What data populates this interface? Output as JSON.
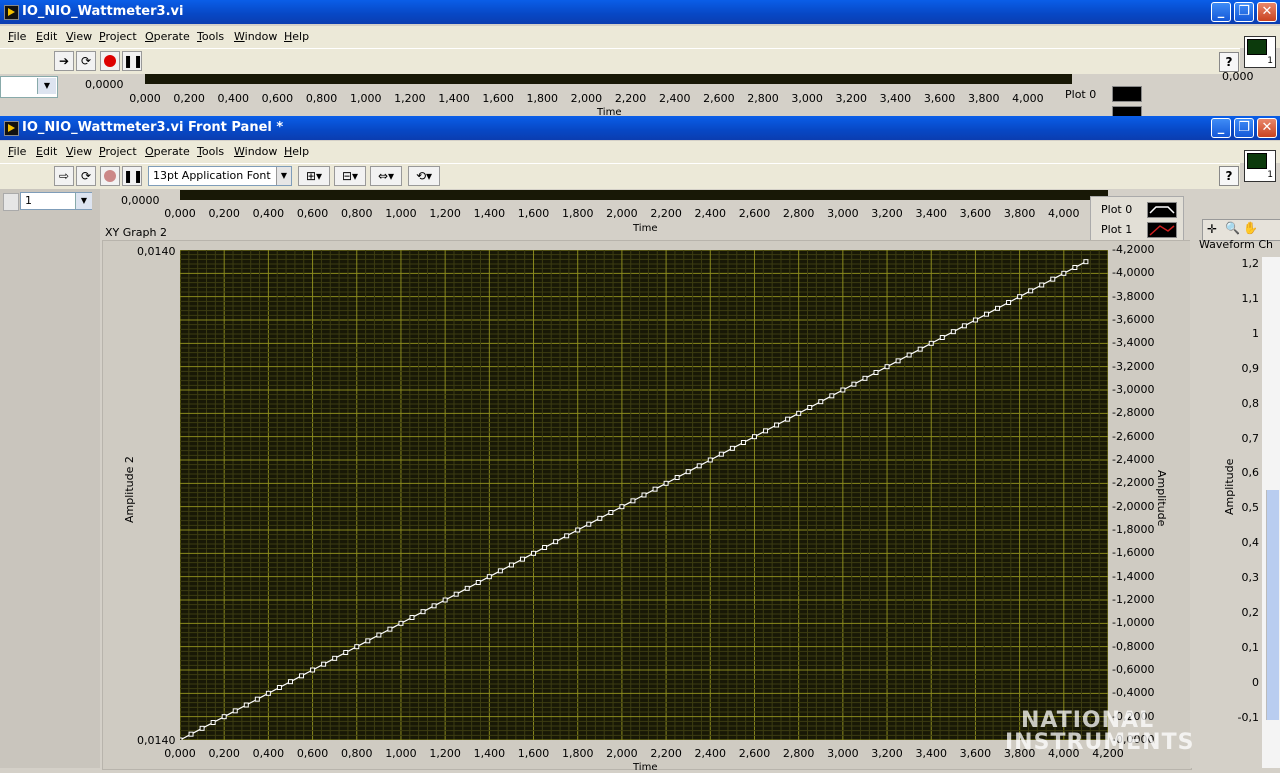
{
  "back_window": {
    "title": "IO_NIO_Wattmeter3.vi",
    "menu": [
      "File",
      "Edit",
      "View",
      "Project",
      "Operate",
      "Tools",
      "Window",
      "Help"
    ],
    "graph": {
      "y_value": "0,0000",
      "legend": [
        "Plot 0",
        "Plot 1"
      ],
      "right_value": "0,000",
      "xlabel": "Time"
    }
  },
  "front_window": {
    "title": "IO_NIO_Wattmeter3.vi Front Panel *",
    "menu": [
      "File",
      "Edit",
      "View",
      "Project",
      "Operate",
      "Tools",
      "Window",
      "Help"
    ],
    "toolbar": {
      "font": "13pt Application Font"
    },
    "icon_number": "1",
    "help": "?",
    "index_control": "1",
    "top_graph": {
      "y_value": "0,0000",
      "xlabel": "Time",
      "legend": [
        "Plot 0",
        "Plot 1"
      ]
    },
    "waveform_chart": {
      "label": "Waveform Ch",
      "ylabel": "Amplitude",
      "ticks": [
        "1,2",
        "1,1",
        "1",
        "0,9",
        "0,8",
        "0,7",
        "0,6",
        "0,5",
        "0,4",
        "0,3",
        "0,2",
        "0,1",
        "0",
        "-0,1"
      ]
    },
    "logo": [
      "NATIONAL",
      "INSTRUMENTS"
    ]
  },
  "chart_data": {
    "type": "scatter",
    "title": "XY Graph 2",
    "xlabel": "Time",
    "ylabel": "Amplitude 2",
    "ylabel_right": "Amplitude",
    "xlim": [
      0,
      4.2
    ],
    "ylim_right": [
      0,
      4.2
    ],
    "x_ticks": [
      "0,000",
      "0,200",
      "0,400",
      "0,600",
      "0,800",
      "1,000",
      "1,200",
      "1,400",
      "1,600",
      "1,800",
      "2,000",
      "2,200",
      "2,400",
      "2,600",
      "2,800",
      "3,000",
      "3,200",
      "3,400",
      "3,600",
      "3,800",
      "4,000",
      "4,200"
    ],
    "y_left_ticks": [
      "0,0140",
      "0,0140"
    ],
    "y_right_ticks": [
      "-4,2000",
      "-4,0000",
      "-3,8000",
      "-3,6000",
      "-3,4000",
      "-3,2000",
      "-3,0000",
      "-2,8000",
      "-2,6000",
      "-2,4000",
      "-2,2000",
      "-2,0000",
      "-1,8000",
      "-1,6000",
      "-1,4000",
      "-1,2000",
      "-1,0000",
      "-0,8000",
      "-0,6000",
      "-0,4000",
      "-0,2000",
      "-0,0000"
    ],
    "series": [
      {
        "x_start": 0,
        "x_end": 4.1,
        "x_step": 0.05,
        "slope": 1
      }
    ],
    "grid": true,
    "colors": {
      "plot_bg": "#181806",
      "grid_major": "#8a8a1e",
      "grid_minor": "#3c3c12",
      "line": "#ffffff"
    }
  }
}
